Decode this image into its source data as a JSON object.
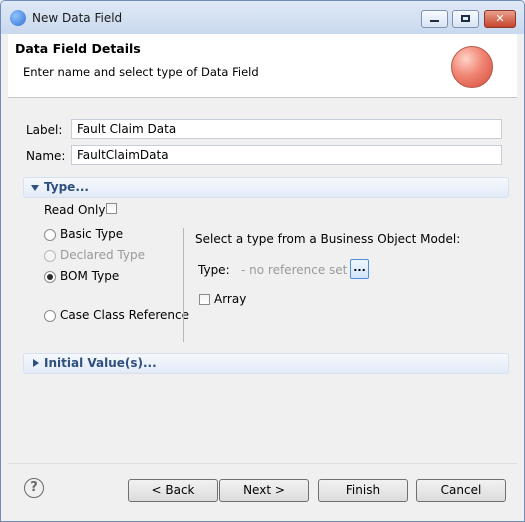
{
  "window": {
    "title": "New Data Field",
    "minimize_label": "",
    "maximize_label": "",
    "close_label": "✕"
  },
  "header": {
    "title": "Data Field Details",
    "description": "Enter name and select type of Data Field"
  },
  "form": {
    "label_caption": "Label:",
    "label_value": "Fault Claim Data",
    "name_caption": "Name:",
    "name_value": "FaultClaimData"
  },
  "type_section": {
    "title": "Type...",
    "read_only_label": "Read Only:",
    "read_only_checked": false,
    "options": [
      {
        "label": "Basic Type",
        "selected": false,
        "enabled": true
      },
      {
        "label": "Declared Type",
        "selected": false,
        "enabled": false
      },
      {
        "label": "BOM Type",
        "selected": true,
        "enabled": true
      },
      {
        "label": "Case Class Reference",
        "selected": false,
        "enabled": true
      }
    ],
    "bom_prompt": "Select a type from a Business Object Model:",
    "type_caption": "Type:",
    "type_value": "- no reference set -",
    "browse_label": "...",
    "array_label": "Array",
    "array_checked": false
  },
  "initial_value_section": {
    "title": "Initial Value(s)..."
  },
  "footer": {
    "help_label": "?",
    "back_label": "< Back",
    "next_label": "Next >",
    "finish_label": "Finish",
    "cancel_label": "Cancel"
  }
}
